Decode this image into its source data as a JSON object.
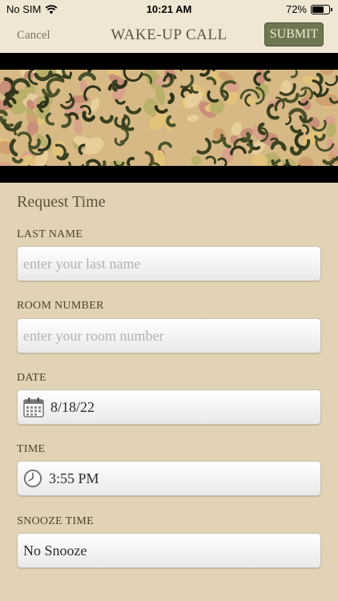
{
  "status_bar": {
    "carrier": "No SIM",
    "time": "10:21 AM",
    "battery": "72%",
    "battery_level": 0.72
  },
  "nav": {
    "cancel_label": "Cancel",
    "title": "WAKE-UP CALL",
    "submit_label": "SUBMIT"
  },
  "form": {
    "section_title": "Request Time",
    "last_name": {
      "label": "LAST NAME",
      "placeholder": "enter your last name"
    },
    "room_number": {
      "label": "ROOM NUMBER",
      "placeholder": "enter your room number"
    },
    "date": {
      "label": "DATE",
      "value": "8/18/22",
      "icon": "calendar-icon"
    },
    "time": {
      "label": "TIME",
      "value": "3:55 PM",
      "icon": "clock-icon"
    },
    "snooze": {
      "label": "SNOOZE TIME",
      "value": "No Snooze"
    }
  },
  "colors": {
    "background": "#e1d3b3",
    "submit": "#6e7850",
    "banner_band": "#000000"
  }
}
